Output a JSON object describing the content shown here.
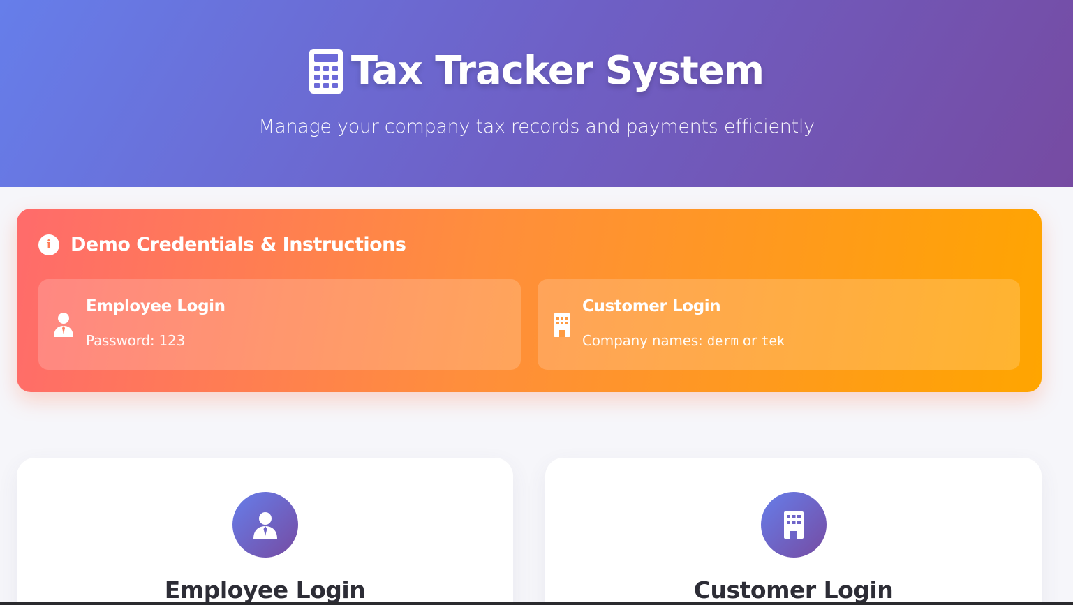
{
  "header": {
    "title": "Tax Tracker System",
    "subtitle": "Manage your company tax records and payments efficiently",
    "icon": "calculator-icon"
  },
  "demo": {
    "title": "Demo Credentials & Instructions",
    "icon": "info-icon",
    "employee": {
      "title": "Employee Login",
      "desc_label": "Password:",
      "password": "123",
      "icon": "user-tie-icon"
    },
    "customer": {
      "title": "Customer Login",
      "desc_label": "Company names:",
      "name1": "derm",
      "joiner": "or",
      "name2": "tek",
      "icon": "building-icon"
    }
  },
  "login": {
    "employee": {
      "title": "Employee Login",
      "icon": "user-tie-icon"
    },
    "customer": {
      "title": "Customer Login",
      "icon": "building-icon"
    }
  },
  "colors": {
    "header_start": "#667eea",
    "header_end": "#764ba2",
    "demo_start": "#ff6b6b",
    "demo_end": "#ffa500"
  }
}
